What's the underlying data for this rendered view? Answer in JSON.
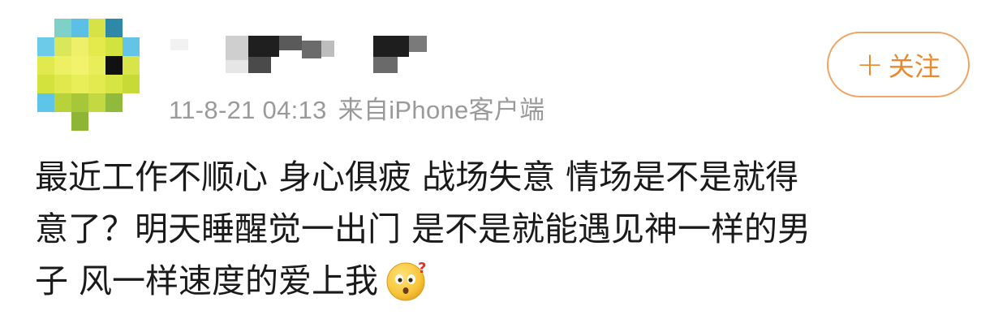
{
  "post": {
    "timestamp": "11-8-21 04:13",
    "source": "来自iPhone客户端",
    "follow_label": "关注",
    "follow_icon": "plus-icon",
    "content_lines": [
      "最近工作不顺心 身心俱疲 战场失意 情场是不是就得",
      "意了？明天睡醒觉一出门 是不是就能遇见神一样的男",
      "子 风一样速度的爱上我"
    ],
    "emoji": "thinking-question-face-icon"
  },
  "colors": {
    "accent": "#ea8a2f",
    "follow_border": "#f0a565",
    "meta_text": "#9a9a9a",
    "body_text": "#1a1a1a"
  }
}
